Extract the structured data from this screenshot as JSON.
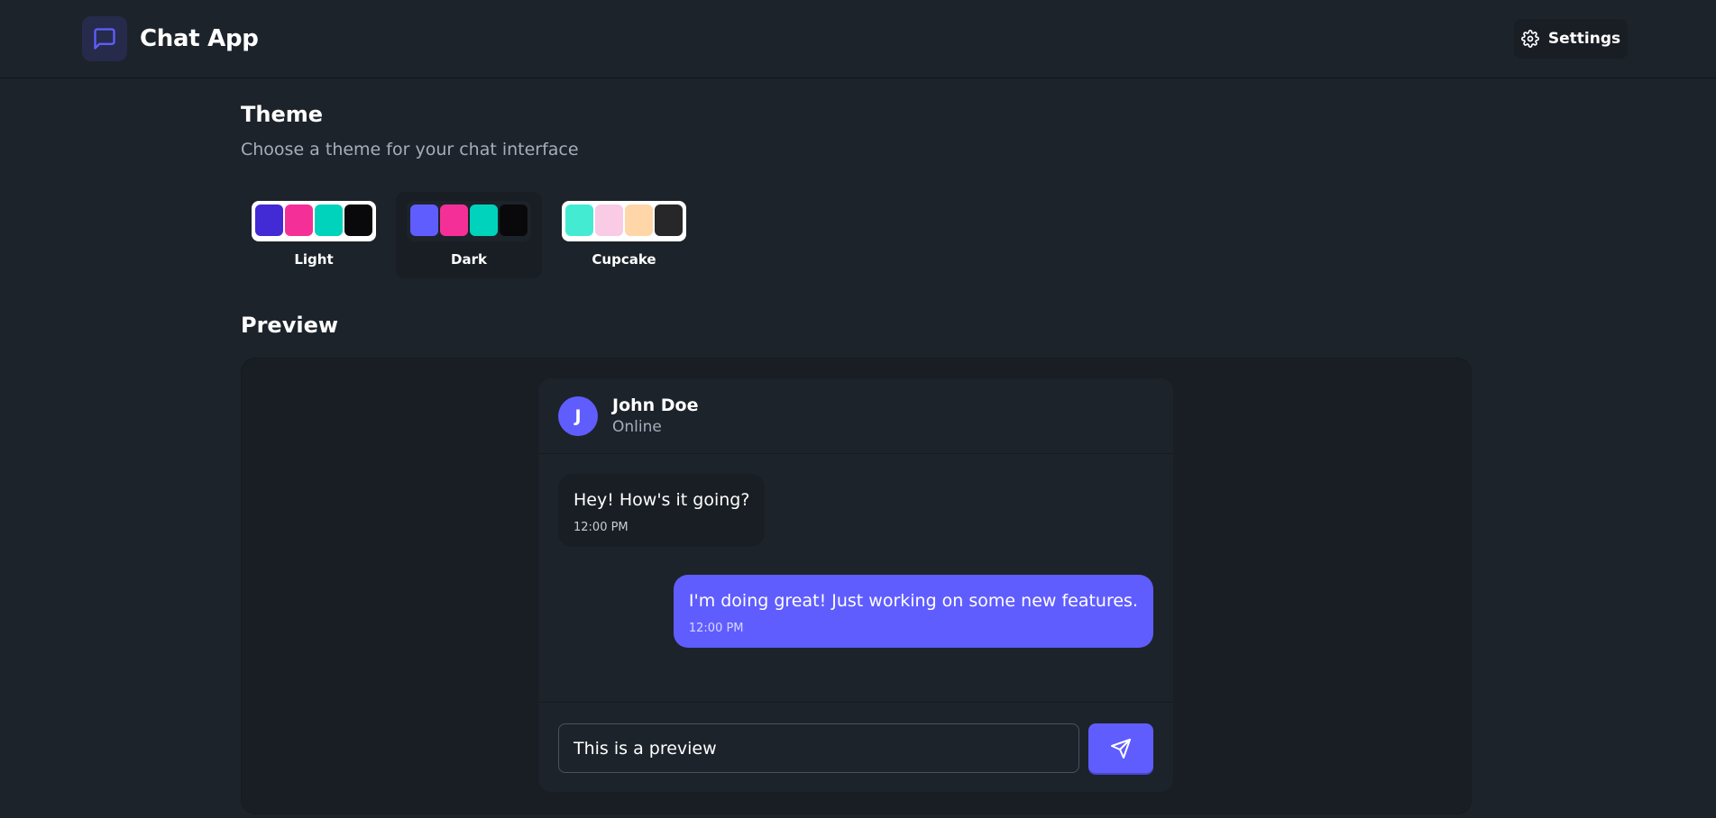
{
  "app": {
    "title": "Chat App",
    "settings_label": "Settings"
  },
  "theme_section": {
    "title": "Theme",
    "subtitle": "Choose a theme for your chat interface",
    "selected": "Dark",
    "themes": [
      {
        "label": "Light",
        "box_bg": "#ffffff",
        "colors": [
          "#422ad5",
          "#f43098",
          "#00d3bb",
          "#09090b"
        ]
      },
      {
        "label": "Dark",
        "box_bg": "#1d232a",
        "colors": [
          "#605dff",
          "#f43098",
          "#00d3bb",
          "#09090b"
        ]
      },
      {
        "label": "Cupcake",
        "box_bg": "#ffffff",
        "colors": [
          "#44ebd3",
          "#f9cbe5",
          "#ffd6a7",
          "#27272a"
        ]
      }
    ]
  },
  "preview": {
    "title": "Preview",
    "contact": {
      "initial": "J",
      "name": "John Doe",
      "status": "Online"
    },
    "messages": [
      {
        "direction": "incoming",
        "text": "Hey! How's it going?",
        "time": "12:00 PM"
      },
      {
        "direction": "outgoing",
        "text": "I'm doing great! Just working on some new features.",
        "time": "12:00 PM"
      }
    ],
    "input_value": "This is a preview"
  },
  "colors": {
    "background": "#1d232a",
    "surface": "#191e24",
    "primary": "#605dff",
    "text": "#ffffff",
    "muted": "#a6adbb"
  }
}
